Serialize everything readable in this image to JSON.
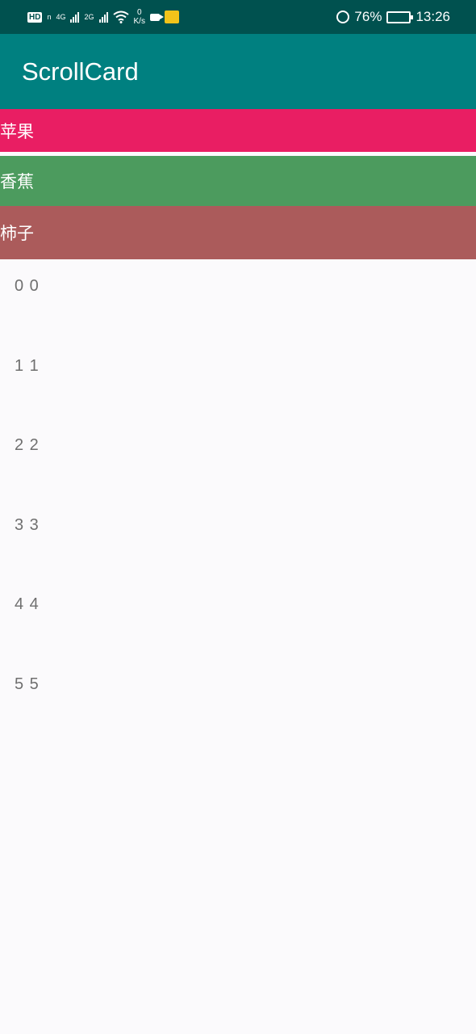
{
  "status_bar": {
    "hd": "HD",
    "hd_sub": "n",
    "sim1_type": "4G",
    "sim2_type": "2G",
    "net_speed_value": "0",
    "net_speed_unit": "K/s",
    "battery_percent": "76%",
    "battery_level": 0.76,
    "time": "13:26",
    "icons": [
      "hd-icon",
      "signal-icon",
      "signal-icon",
      "wifi-icon",
      "video-icon",
      "sim-card-icon",
      "alarm-icon",
      "battery-icon"
    ]
  },
  "app_bar": {
    "title": "ScrollCard",
    "color": "#008080"
  },
  "categories": [
    {
      "label": "苹果",
      "color": "#e91e63"
    },
    {
      "label": "香蕉",
      "color": "#4c9b5e"
    },
    {
      "label": "柿子",
      "color": "#ab5b5b"
    }
  ],
  "list": [
    {
      "label": "0 0"
    },
    {
      "label": "1 1"
    },
    {
      "label": "2 2"
    },
    {
      "label": "3 3"
    },
    {
      "label": "4 4"
    },
    {
      "label": "5 5"
    }
  ]
}
